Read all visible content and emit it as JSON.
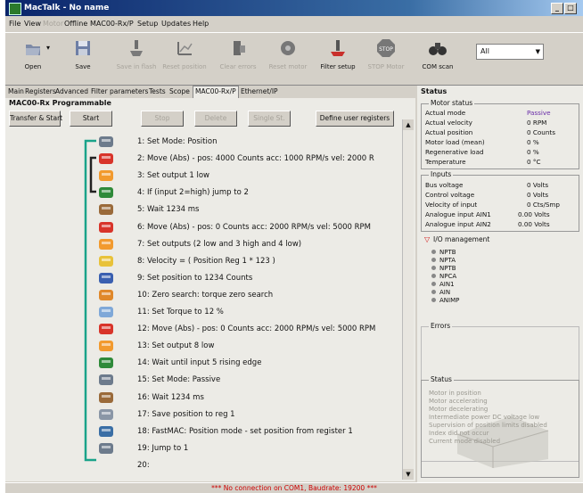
{
  "window": {
    "title": "MacTalk - No name"
  },
  "menu": [
    "File",
    "View",
    "Motor",
    "Offline",
    "MAC00-Rx/P",
    "Setup",
    "Updates",
    "Help"
  ],
  "toolbar": {
    "buttons": [
      {
        "label": "Open",
        "icon": "open-folder-icon",
        "enabled": true
      },
      {
        "label": "Save",
        "icon": "save-disk-icon",
        "enabled": true
      },
      {
        "label": "Save in flash",
        "icon": "save-in-flash-icon",
        "enabled": false
      },
      {
        "label": "Reset position",
        "icon": "reset-position-icon",
        "enabled": false
      },
      {
        "label": "Clear errors",
        "icon": "clear-errors-icon",
        "enabled": false
      },
      {
        "label": "Reset motor",
        "icon": "reset-motor-icon",
        "enabled": false
      },
      {
        "label": "Filter setup",
        "icon": "filter-setup-icon",
        "enabled": true
      },
      {
        "label": "STOP Motor",
        "icon": "stop-sign-icon",
        "enabled": false
      },
      {
        "label": "COM scan",
        "icon": "binoculars-icon",
        "enabled": true
      }
    ],
    "combo_value": "All"
  },
  "tabs": [
    {
      "label": "Main",
      "active": false
    },
    {
      "label": "Registers",
      "active": false
    },
    {
      "label": "Advanced",
      "active": false
    },
    {
      "label": "Filter parameters",
      "active": false
    },
    {
      "label": "Tests",
      "active": false
    },
    {
      "label": "Scope",
      "active": false
    },
    {
      "label": "MAC00-Rx/P",
      "active": true
    },
    {
      "label": "Ethernet/IP",
      "active": false
    }
  ],
  "program": {
    "title": "MAC00-Rx Programmable",
    "buttons": [
      {
        "label": "Transfer & Start",
        "enabled": true
      },
      {
        "label": "Start",
        "enabled": true
      },
      {
        "label": "Stop",
        "enabled": false
      },
      {
        "label": "Delete",
        "enabled": false
      },
      {
        "label": "Single St.",
        "enabled": false
      },
      {
        "label": "Define user registers",
        "enabled": true
      }
    ],
    "lines": [
      {
        "text": "1: Set Mode: Position",
        "icon": "set-mode-icon"
      },
      {
        "text": "2: Move (Abs) - pos: 4000 Counts acc: 1000 RPM/s vel: 2000 R",
        "icon": "move-icon"
      },
      {
        "text": "3: Set output 1 low",
        "icon": "set-output-icon"
      },
      {
        "text": "4: If (input 2=high) jump to 2",
        "icon": "conditional-jump-icon"
      },
      {
        "text": "5: Wait 1234 ms",
        "icon": "wait-icon"
      },
      {
        "text": "6: Move (Abs) - pos: 0 Counts acc: 2000 RPM/s vel: 5000 RPM",
        "icon": "move-icon"
      },
      {
        "text": "7: Set outputs (2 low and 3 high and 4 low)",
        "icon": "set-outputs-icon"
      },
      {
        "text": "8: Velocity = ( Position Reg 1 * 123 )",
        "icon": "calculate-icon"
      },
      {
        "text": "9: Set position to 1234 Counts",
        "icon": "set-position-icon"
      },
      {
        "text": "10: Zero search: torque zero search",
        "icon": "zero-search-icon"
      },
      {
        "text": "11: Set Torque to 12 %",
        "icon": "set-torque-icon"
      },
      {
        "text": "12: Move (Abs) - pos: 0 Counts acc: 2000 RPM/s vel: 5000 RPM",
        "icon": "move-icon"
      },
      {
        "text": "13: Set output 8 low",
        "icon": "set-output-icon"
      },
      {
        "text": "14: Wait until input 5 rising edge",
        "icon": "wait-input-icon"
      },
      {
        "text": "15: Set Mode: Passive",
        "icon": "set-mode-icon"
      },
      {
        "text": "16: Wait 1234 ms",
        "icon": "wait-icon"
      },
      {
        "text": "17: Save position to reg 1",
        "icon": "save-position-icon"
      },
      {
        "text": "18: FastMAC: Position mode - set position from register 1",
        "icon": "fastmac-icon"
      },
      {
        "text": "19: Jump to 1",
        "icon": "jump-icon"
      },
      {
        "text": "20:",
        "icon": "empty-slot"
      }
    ]
  },
  "status": {
    "title": "Status",
    "motor_status_label": "Motor status",
    "motor_rows": [
      {
        "label": "Actual mode",
        "value": "Passive"
      },
      {
        "label": "Actual velocity",
        "value": "0 RPM"
      },
      {
        "label": "Actual position",
        "value": "0 Counts"
      },
      {
        "label": "Motor load (mean)",
        "value": "0 %"
      },
      {
        "label": "Regenerative load",
        "value": "0 %"
      },
      {
        "label": "Temperature",
        "value": "0 °C"
      }
    ],
    "inputs_label": "Inputs",
    "input_rows": [
      {
        "label": "Bus voltage",
        "value": "0 Volts"
      },
      {
        "label": "Control voltage",
        "value": "0 Volts"
      },
      {
        "label": "Velocity of input",
        "value": "0 Cts/Smp"
      },
      {
        "label": "Analogue input AIN1",
        "value": "0.00 Volts"
      },
      {
        "label": "Analogue input AIN2",
        "value": "0.00 Volts"
      }
    ],
    "io_label": "I/O management",
    "io_items": [
      "NPTB",
      "NPTA",
      "NPTB",
      "NPCA",
      "AIN1",
      "AIN",
      "ANIMP"
    ],
    "errors_label": "Errors",
    "status_label": "Status",
    "status_items": [
      "Motor in position",
      "Motor accelerating",
      "Motor decelerating",
      "Intermediate power DC voltage low",
      "Supervision of position limits disabled",
      "Index did not occur",
      "Current mode disabled"
    ]
  },
  "statusbar": {
    "message": "*** No connection on COM1, Baudrate: 19200 ***"
  },
  "colors": {
    "accent_green": "#1aa38a",
    "error_red": "#cc0000",
    "passive_purple": "#6a2da8",
    "io_arrow": "#d01010"
  }
}
